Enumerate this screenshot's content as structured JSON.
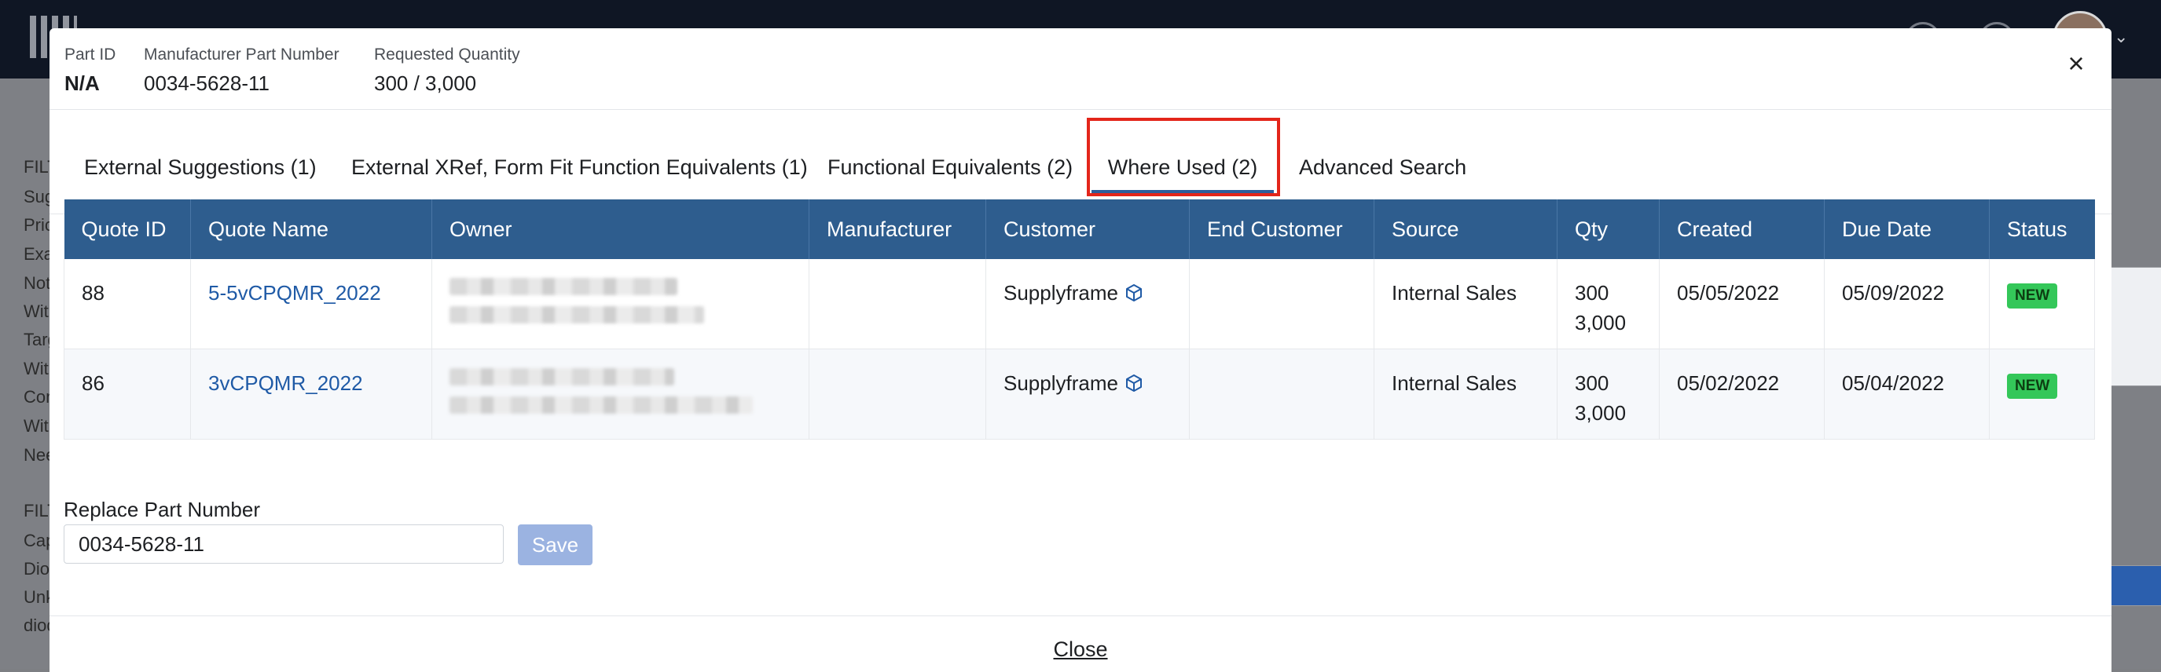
{
  "app": {
    "side_filters_1": [
      "FILTE",
      "Sugg",
      "Prici",
      "Exa",
      "Not",
      "With",
      "Targ",
      "With",
      "Con",
      "With",
      "Nee"
    ],
    "side_filters_2": [
      "FILTE",
      "Cap",
      "Diod",
      "Unk",
      "diod"
    ]
  },
  "modal": {
    "part_id_label": "Part ID",
    "part_id_value": "N/A",
    "mpn_label": "Manufacturer Part Number",
    "mpn_value": "0034-5628-11",
    "qty_label": "Requested Quantity",
    "qty_value": "300 / 3,000",
    "tabs": [
      {
        "label": "External Suggestions (1)",
        "active": false
      },
      {
        "label": "External XRef, Form Fit Function Equivalents (1)",
        "active": false
      },
      {
        "label": "Functional Equivalents (2)",
        "active": false
      },
      {
        "label": "Where Used (2)",
        "active": true
      },
      {
        "label": "Advanced Search",
        "active": false
      }
    ],
    "table": {
      "headers": [
        "Quote ID",
        "Quote Name",
        "Owner",
        "Manufacturer",
        "Customer",
        "End Customer",
        "Source",
        "Qty",
        "Created",
        "Due Date",
        "Status"
      ],
      "rows": [
        {
          "quote_id": "88",
          "quote_name": "5-5vCPQMR_2022",
          "manufacturer": "",
          "customer": "Supplyframe",
          "end_customer": "",
          "source": "Internal Sales",
          "qty_1": "300",
          "qty_2": "3,000",
          "created": "05/05/2022",
          "due_date": "05/09/2022",
          "status": "NEW"
        },
        {
          "quote_id": "86",
          "quote_name": "3vCPQMR_2022",
          "manufacturer": "",
          "customer": "Supplyframe",
          "end_customer": "",
          "source": "Internal Sales",
          "qty_1": "300",
          "qty_2": "3,000",
          "created": "05/02/2022",
          "due_date": "05/04/2022",
          "status": "NEW"
        }
      ]
    },
    "replace_label": "Replace Part Number",
    "replace_value": "0034-5628-11",
    "save_label": "Save",
    "close_label": "Close",
    "close_icon": "×"
  },
  "colors": {
    "header_bg": "#2e5d8e",
    "link": "#1f5aa6",
    "status_new": "#34c759",
    "highlight": "#e3251a",
    "save_disabled": "#9bb3e1"
  }
}
